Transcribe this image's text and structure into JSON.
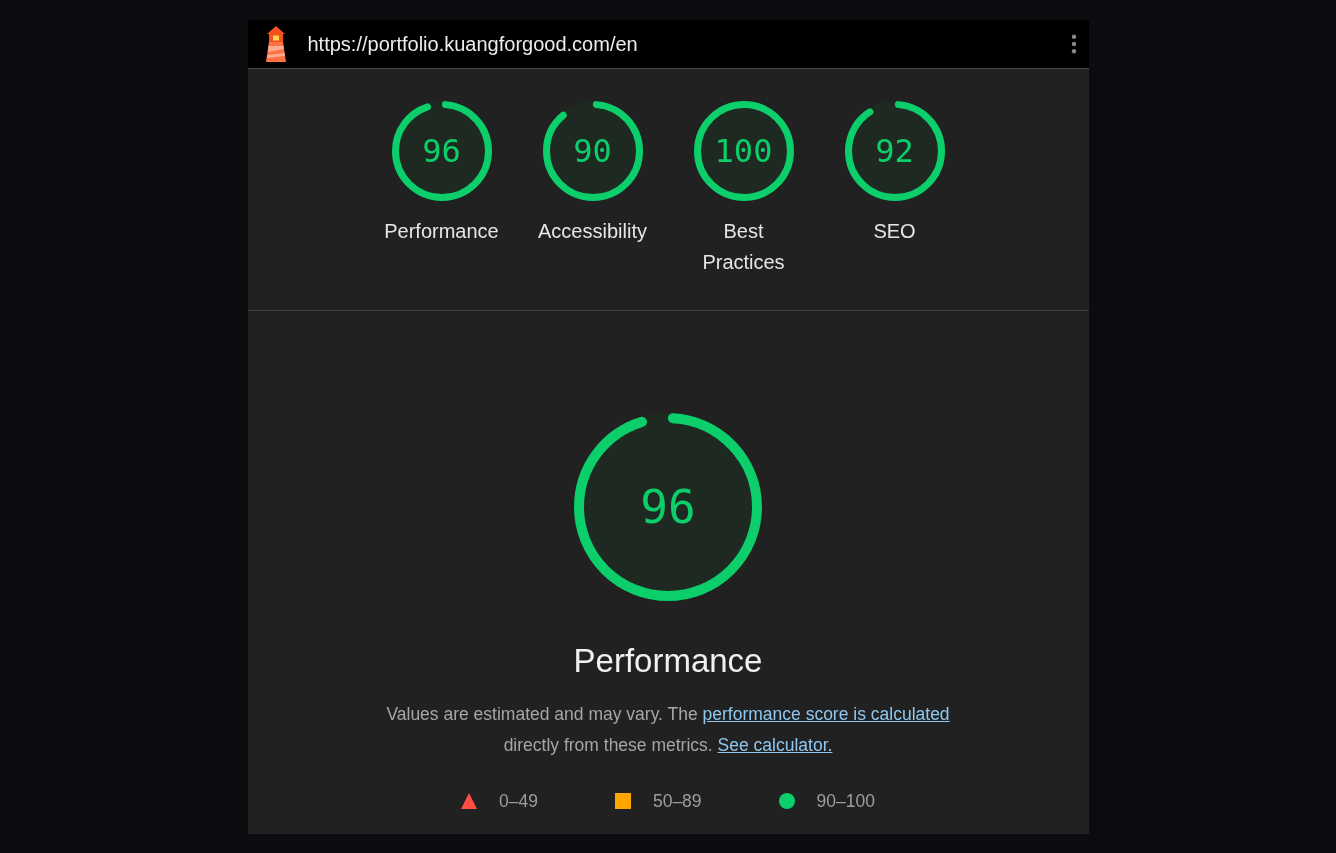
{
  "header": {
    "url": "https://portfolio.kuangforgood.com/en"
  },
  "summary": [
    {
      "label": "Performance",
      "score": "96",
      "level": 0.96
    },
    {
      "label": "Accessibility",
      "score": "90",
      "level": 0.9
    },
    {
      "label": "Best Practices",
      "score": "100",
      "level": 1
    },
    {
      "label": "SEO",
      "score": "92",
      "level": 0.92
    }
  ],
  "category": {
    "score": "96",
    "level": 0.96,
    "title": "Performance",
    "description": [
      {
        "kind": "text",
        "text": "Values are estimated and may vary. The "
      },
      {
        "kind": "link",
        "text": "performance score is calculated"
      },
      {
        "kind": "text",
        "text": " directly from these metrics. "
      },
      {
        "kind": "link",
        "text": "See calculator."
      }
    ],
    "legend": [
      {
        "kind": "triangle",
        "color": "#ff4e42",
        "label": "0–49"
      },
      {
        "kind": "square",
        "color": "#ffa400",
        "label": "50–89"
      },
      {
        "kind": "circle",
        "color": "#0cce6b",
        "label": "90–100"
      }
    ]
  }
}
